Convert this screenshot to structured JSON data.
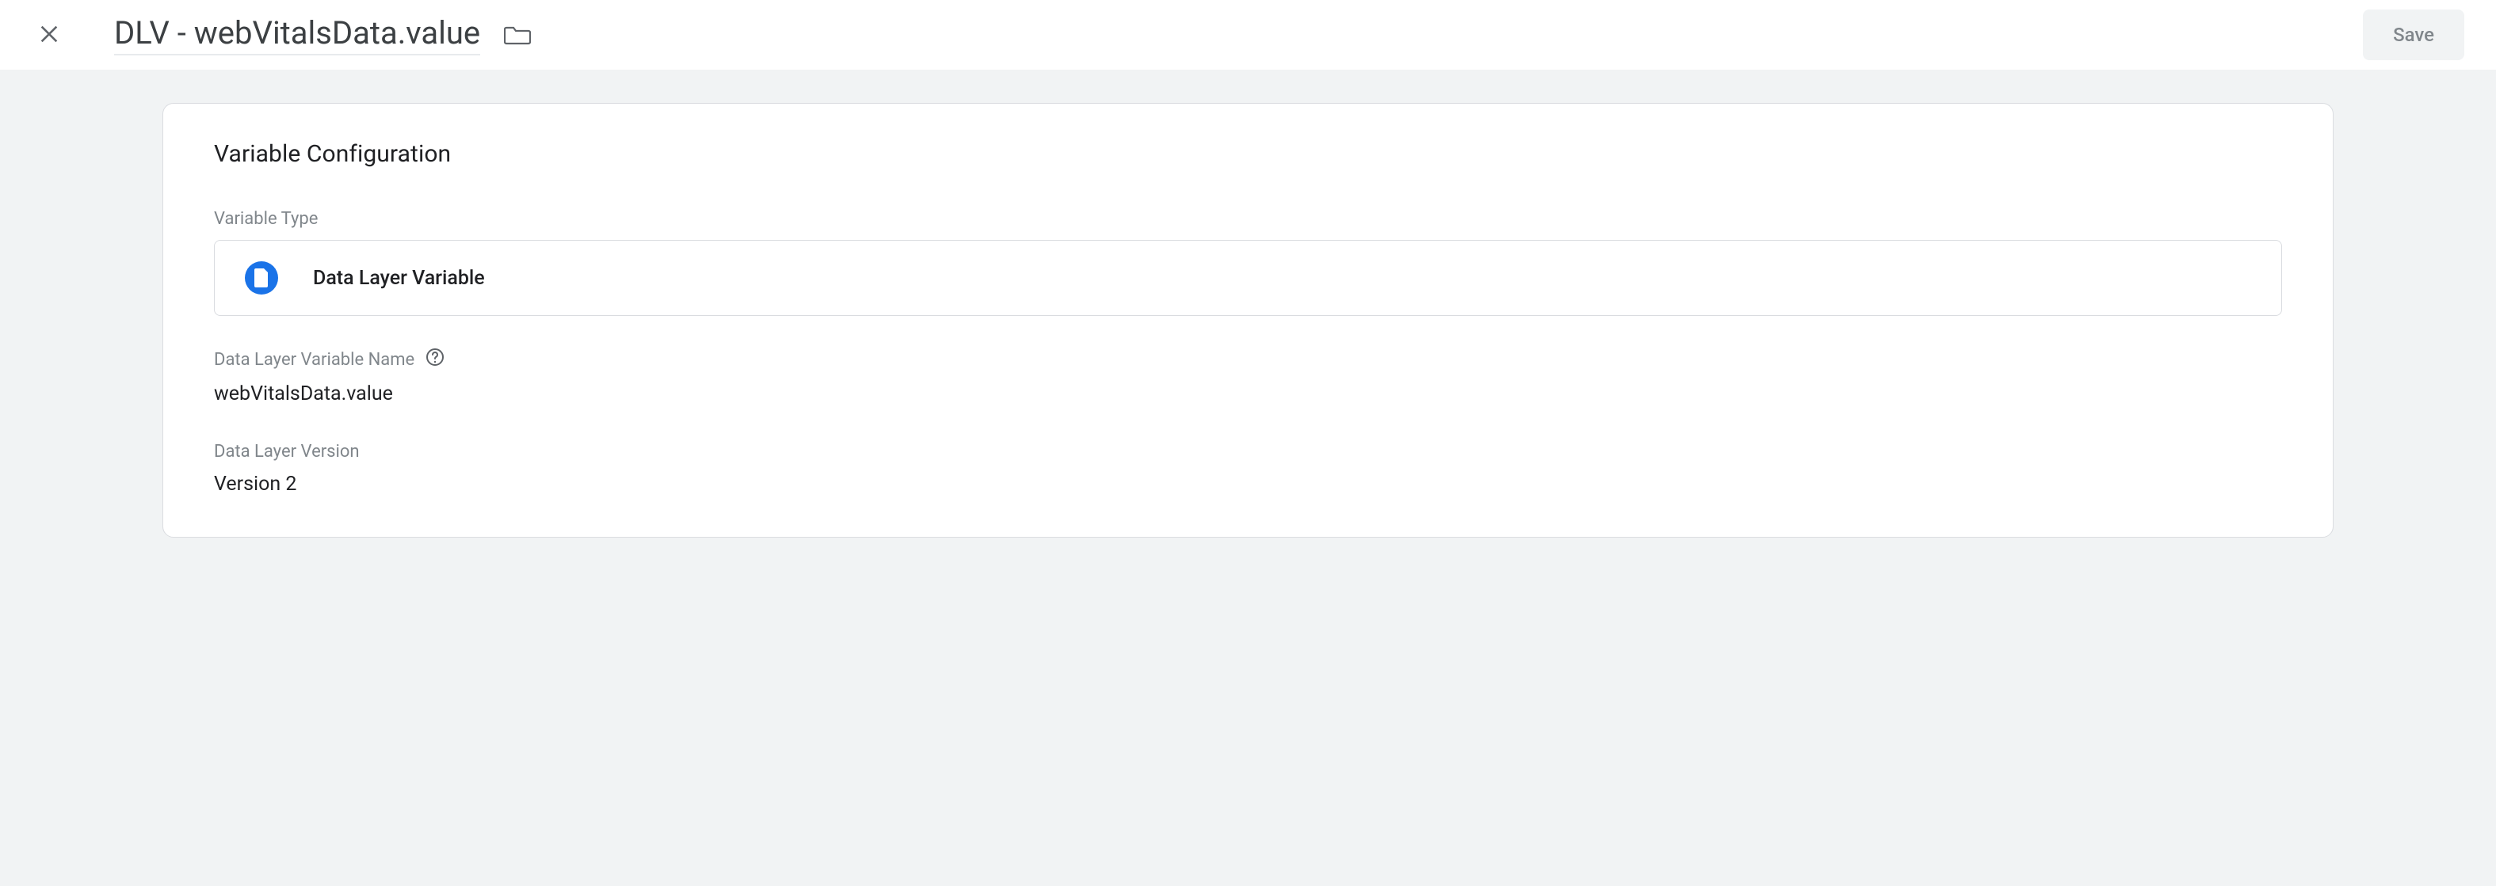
{
  "header": {
    "title": "DLV - webVitalsData.value",
    "save_label": "Save"
  },
  "config": {
    "section_title": "Variable Configuration",
    "variable_type_label": "Variable Type",
    "variable_type_value": "Data Layer Variable",
    "name_label": "Data Layer Variable Name",
    "name_value": "webVitalsData.value",
    "version_label": "Data Layer Version",
    "version_value": "Version 2"
  }
}
